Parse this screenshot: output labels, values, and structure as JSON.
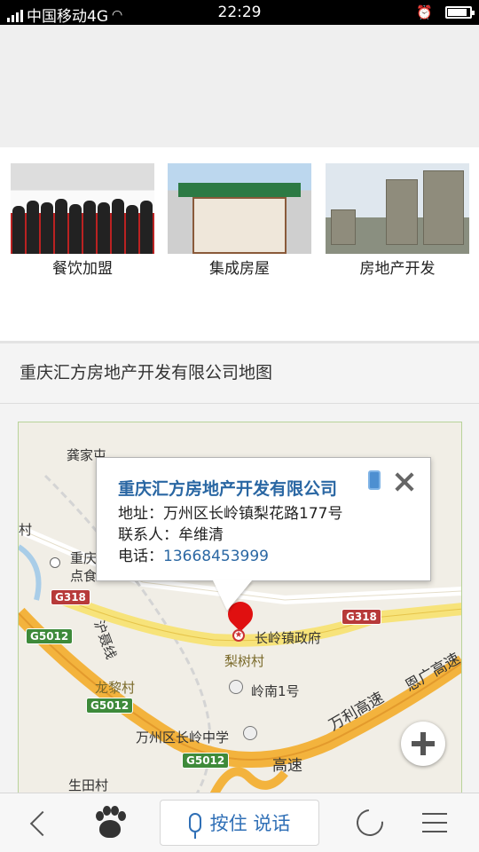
{
  "status_bar": {
    "carrier": "中国移动4G",
    "time": "22:29"
  },
  "categories": [
    {
      "label": "餐饮加盟"
    },
    {
      "label": "集成房屋"
    },
    {
      "label": "房地产开发"
    }
  ],
  "map_section": {
    "title": "重庆汇方房地产开发有限公司地图"
  },
  "info_window": {
    "company": "重庆汇方房地产开发有限公司",
    "address_label": "地址：",
    "address": "万州区长岭镇梨花路177号",
    "contact_label": "联系人：",
    "contact": "牟维清",
    "phone_label": "电话：",
    "phone": "13668453999"
  },
  "map_labels": {
    "gongjia": "龚家屯",
    "cun": "村",
    "chongqing": "重庆",
    "dianshi": "点食",
    "yishan_line": "沪聂线",
    "zhenzhengfu": "长岭镇政府",
    "lishu": "梨树村",
    "longli": "龙黎村",
    "lingnan": "岭南1号",
    "zhongxue": "万州区长岭中学",
    "shengtian": "生田村",
    "wanli": "万利高速",
    "enguang": "恩广高速",
    "gaosu": "高速",
    "g318_left": "G318",
    "g318_right": "G318",
    "g5012_top": "G5012",
    "g5012_mid": "G5012",
    "g5012_bottom": "G5012"
  },
  "bottom_bar": {
    "voice_label": "按住 说话"
  },
  "colors": {
    "link_blue": "#2a67a3",
    "highway_orange": "#f3b33d",
    "pin_red": "#e01010"
  }
}
